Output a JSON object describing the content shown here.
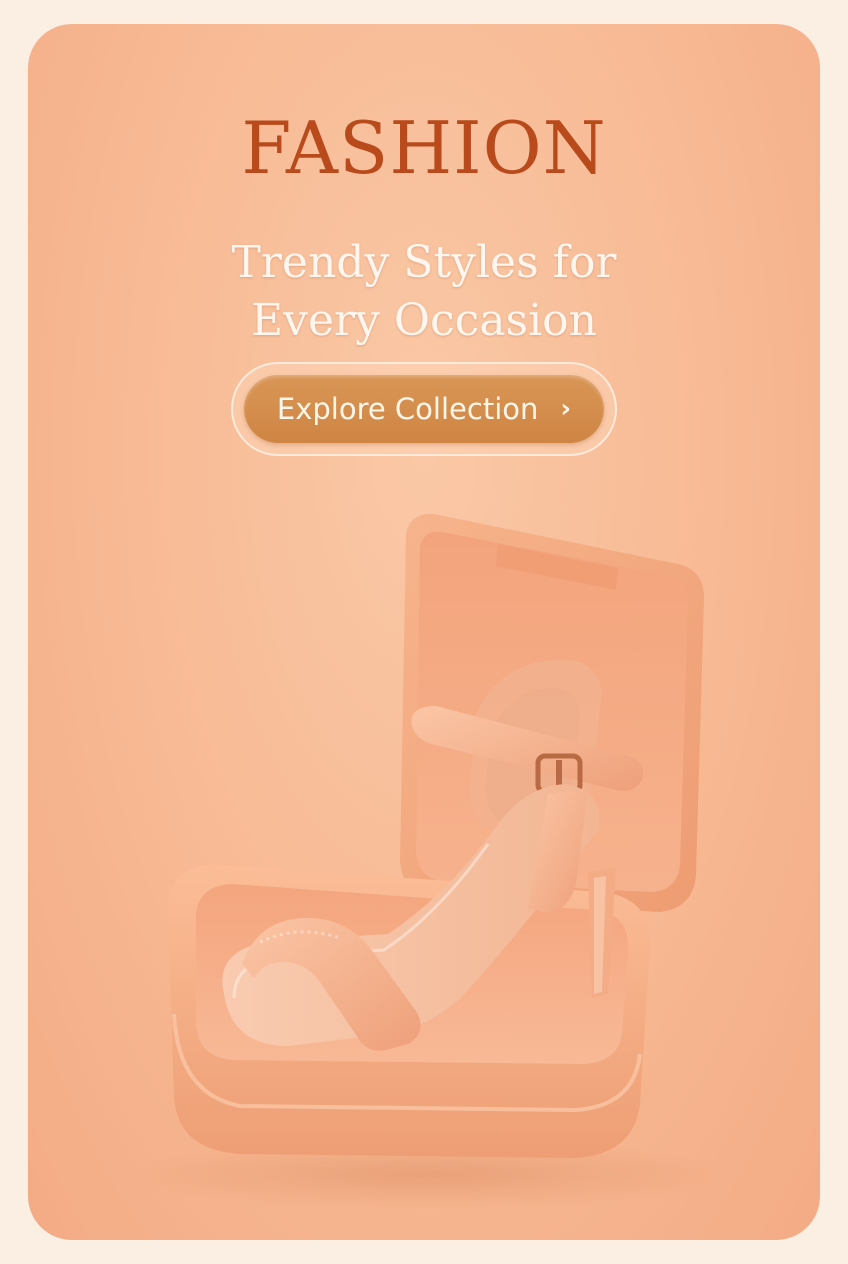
{
  "banner": {
    "headline": "FASHION",
    "subtitle_line1": "Trendy Styles for",
    "subtitle_line2": "Every Occasion",
    "cta_label": "Explore Collection",
    "cta_icon": "chevron-right-icon"
  },
  "product_image": {
    "subject": "high-heel-sandal-in-open-box"
  },
  "colors": {
    "background": "#f7b993",
    "headline": "#b94a1c",
    "subtitle": "#fff7ef",
    "button": "#d08a4a",
    "button_text": "#fff6ea"
  }
}
